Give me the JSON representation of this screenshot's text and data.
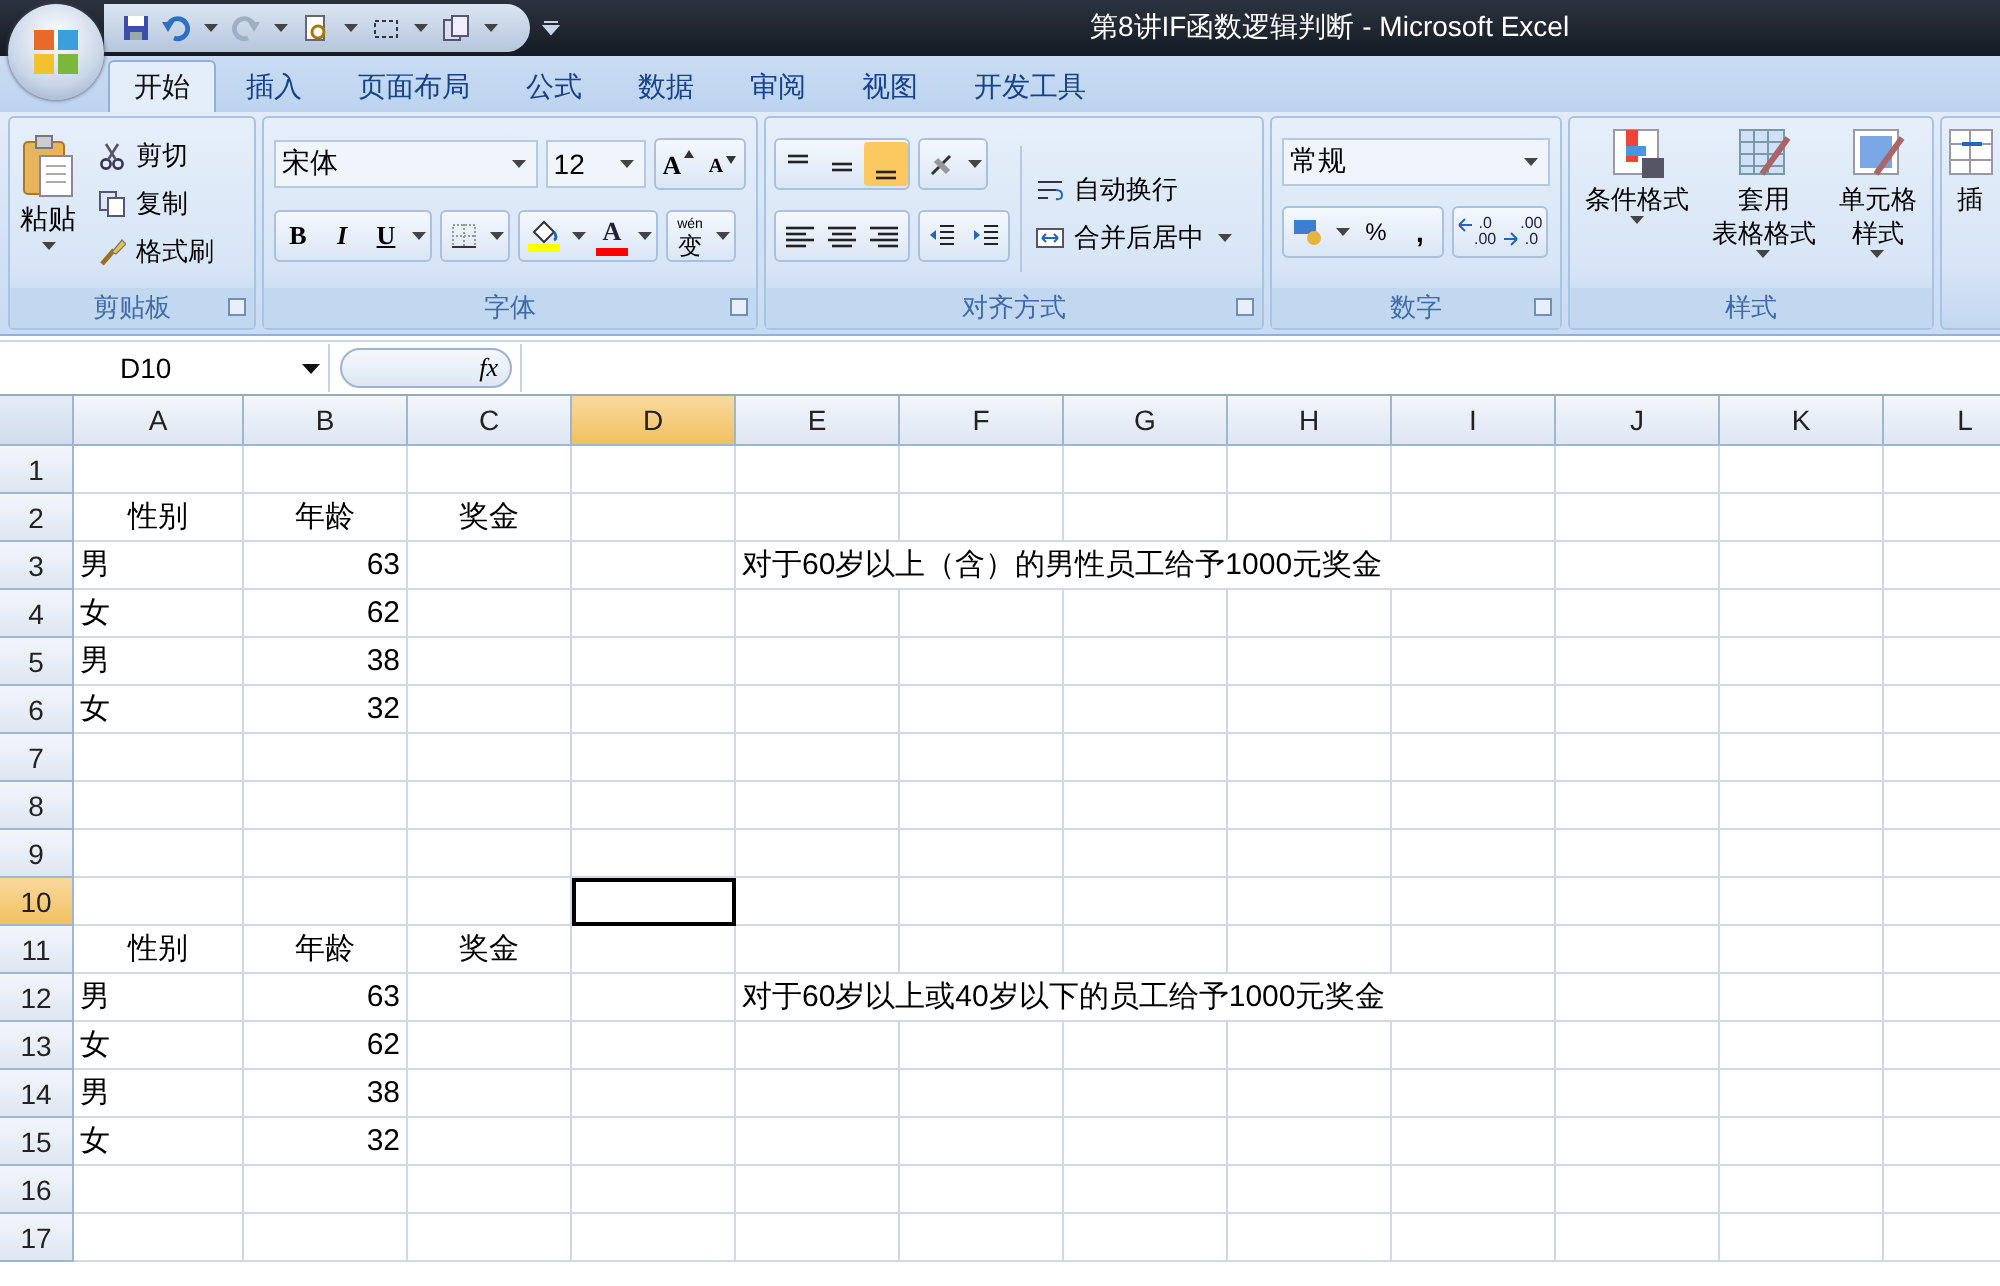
{
  "title_bar": {
    "title": "第8讲IF函数逻辑判断 - Microsoft Excel"
  },
  "quick_access": [
    {
      "kind": "save"
    },
    {
      "kind": "undo"
    },
    {
      "kind": "redo"
    },
    {
      "kind": "preview"
    },
    {
      "kind": "select"
    },
    {
      "kind": "copy"
    }
  ],
  "tabs": [
    {
      "label": "开始",
      "selected": true
    },
    {
      "label": "插入",
      "selected": false
    },
    {
      "label": "页面布局",
      "selected": false
    },
    {
      "label": "公式",
      "selected": false
    },
    {
      "label": "数据",
      "selected": false
    },
    {
      "label": "审阅",
      "selected": false
    },
    {
      "label": "视图",
      "selected": false
    },
    {
      "label": "开发工具",
      "selected": false
    }
  ],
  "ribbon": {
    "clipboard": {
      "label": "剪贴板",
      "paste": "粘贴",
      "actions": [
        {
          "kind": "cut",
          "label": "剪切"
        },
        {
          "kind": "copy",
          "label": "复制"
        },
        {
          "kind": "painter",
          "label": "格式刷"
        }
      ]
    },
    "font": {
      "label": "字体",
      "font_name": "宋体",
      "font_size": "12",
      "grow": "A",
      "shrink": "A",
      "bold": "B",
      "italic": "I",
      "underline": "U",
      "font_color_glyph": "A",
      "phonetic_top": "wén",
      "phonetic_glyph": "变"
    },
    "alignment": {
      "label": "对齐方式",
      "buttons": [
        {
          "kind": "top",
          "selected": false
        },
        {
          "kind": "middle",
          "selected": false
        },
        {
          "kind": "bottom",
          "selected": true
        },
        {
          "kind": "left",
          "selected": false
        },
        {
          "kind": "center",
          "selected": false
        },
        {
          "kind": "right",
          "selected": false
        }
      ],
      "wrap_text": "自动换行",
      "merge_center": "合并后居中"
    },
    "number": {
      "label": "数字",
      "format": "常规",
      "percent": "%",
      "comma": ",",
      "decimals": [
        {
          "kind": "increase",
          "top": ".0",
          "bottom": ".00"
        },
        {
          "kind": "decrease",
          "top": ".00",
          "bottom": ".0"
        }
      ]
    },
    "styles": {
      "label": "样式",
      "buttons": [
        {
          "kind": "conditional",
          "lines": [
            "条件格式"
          ]
        },
        {
          "kind": "table",
          "lines": [
            "套用",
            "表格格式"
          ]
        },
        {
          "kind": "cell",
          "lines": [
            "单元格",
            "样式"
          ]
        }
      ]
    },
    "cells": {
      "insert": "插"
    }
  },
  "name_box": "D10",
  "formula_bar": {
    "function_label": "fx"
  },
  "sheet": {
    "columns": [
      {
        "label": "A",
        "selected": false
      },
      {
        "label": "B",
        "selected": false
      },
      {
        "label": "C",
        "selected": false
      },
      {
        "label": "D",
        "selected": true
      },
      {
        "label": "E",
        "selected": false
      },
      {
        "label": "F",
        "selected": false
      },
      {
        "label": "G",
        "selected": false
      },
      {
        "label": "H",
        "selected": false
      },
      {
        "label": "I",
        "selected": false
      },
      {
        "label": "J",
        "selected": false
      },
      {
        "label": "K",
        "selected": false
      },
      {
        "label": "L",
        "selected": false
      }
    ],
    "rows": [
      {
        "label": "1",
        "selected": false,
        "cells": {}
      },
      {
        "label": "2",
        "selected": false,
        "cells": {
          "a": {
            "text": "性别",
            "kind": "header"
          },
          "b": {
            "text": "年龄",
            "kind": "header"
          },
          "c": {
            "text": "奖金",
            "kind": "header"
          }
        }
      },
      {
        "label": "3",
        "selected": false,
        "cells": {
          "a": {
            "text": "男",
            "kind": "text"
          },
          "b": {
            "text": "63",
            "kind": "number"
          },
          "e": {
            "text": "对于60岁以上（含）的男性员工给予1000元奖金",
            "kind": "text"
          }
        }
      },
      {
        "label": "4",
        "selected": false,
        "cells": {
          "a": {
            "text": "女",
            "kind": "text"
          },
          "b": {
            "text": "62",
            "kind": "number"
          }
        }
      },
      {
        "label": "5",
        "selected": false,
        "cells": {
          "a": {
            "text": "男",
            "kind": "text"
          },
          "b": {
            "text": "38",
            "kind": "number"
          }
        }
      },
      {
        "label": "6",
        "selected": false,
        "cells": {
          "a": {
            "text": "女",
            "kind": "text"
          },
          "b": {
            "text": "32",
            "kind": "number"
          }
        }
      },
      {
        "label": "7",
        "selected": false,
        "cells": {}
      },
      {
        "label": "8",
        "selected": false,
        "cells": {}
      },
      {
        "label": "9",
        "selected": false,
        "cells": {}
      },
      {
        "label": "10",
        "selected": true,
        "cells": {
          "d": {
            "selected": true
          }
        }
      },
      {
        "label": "11",
        "selected": false,
        "cells": {
          "a": {
            "text": "性别",
            "kind": "header"
          },
          "b": {
            "text": "年龄",
            "kind": "header"
          },
          "c": {
            "text": "奖金",
            "kind": "header"
          }
        }
      },
      {
        "label": "12",
        "selected": false,
        "cells": {
          "a": {
            "text": "男",
            "kind": "text"
          },
          "b": {
            "text": "63",
            "kind": "number"
          },
          "e": {
            "text": "对于60岁以上或40岁以下的员工给予1000元奖金",
            "kind": "text"
          }
        }
      },
      {
        "label": "13",
        "selected": false,
        "cells": {
          "a": {
            "text": "女",
            "kind": "text"
          },
          "b": {
            "text": "62",
            "kind": "number"
          }
        }
      },
      {
        "label": "14",
        "selected": false,
        "cells": {
          "a": {
            "text": "男",
            "kind": "text"
          },
          "b": {
            "text": "38",
            "kind": "number"
          }
        }
      },
      {
        "label": "15",
        "selected": false,
        "cells": {
          "a": {
            "text": "女",
            "kind": "text"
          },
          "b": {
            "text": "32",
            "kind": "number"
          }
        }
      },
      {
        "label": "16",
        "selected": false,
        "cells": {}
      },
      {
        "label": "17",
        "selected": false,
        "cells": {}
      }
    ]
  }
}
